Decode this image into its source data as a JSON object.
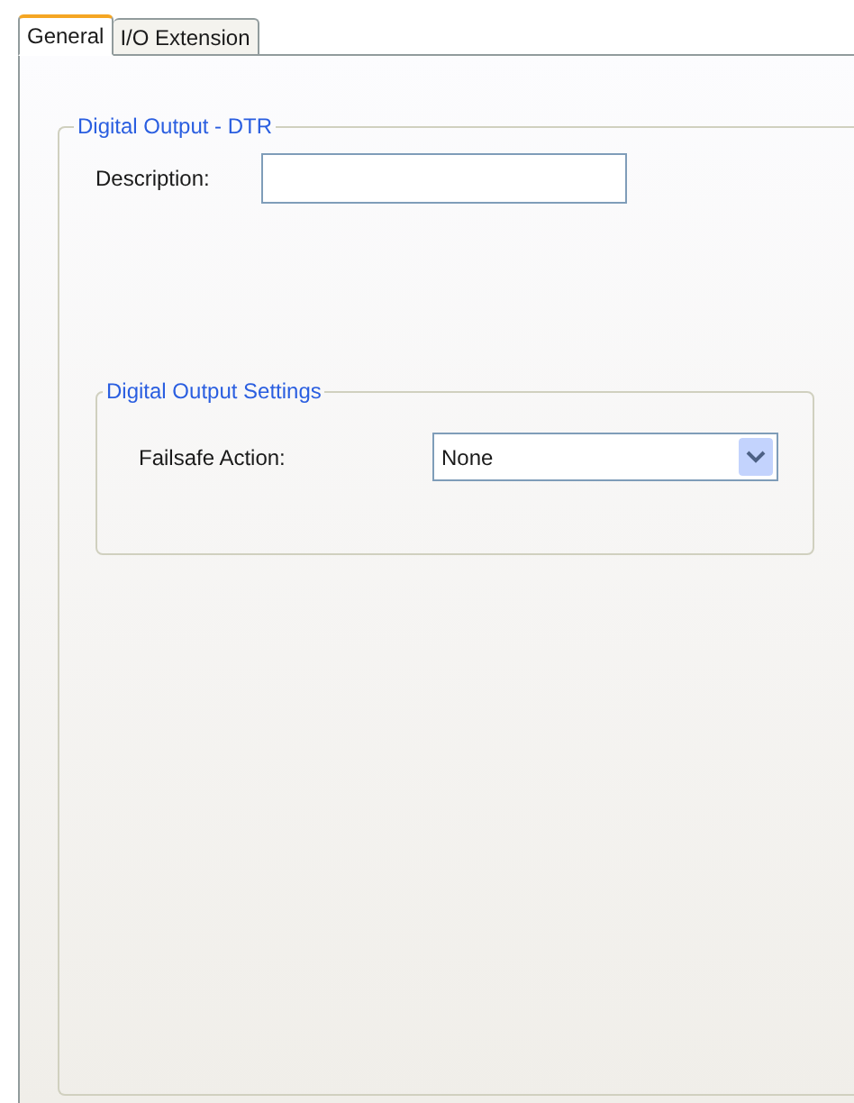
{
  "tabs": [
    {
      "label": "General",
      "selected": true
    },
    {
      "label": "I/O Extension",
      "selected": false
    }
  ],
  "group": {
    "title": "Digital Output - DTR",
    "description": {
      "label": "Description:"
    },
    "settings": {
      "title": "Digital Output Settings",
      "failsafe": {
        "label": "Failsafe Action:",
        "value": "None"
      }
    }
  }
}
